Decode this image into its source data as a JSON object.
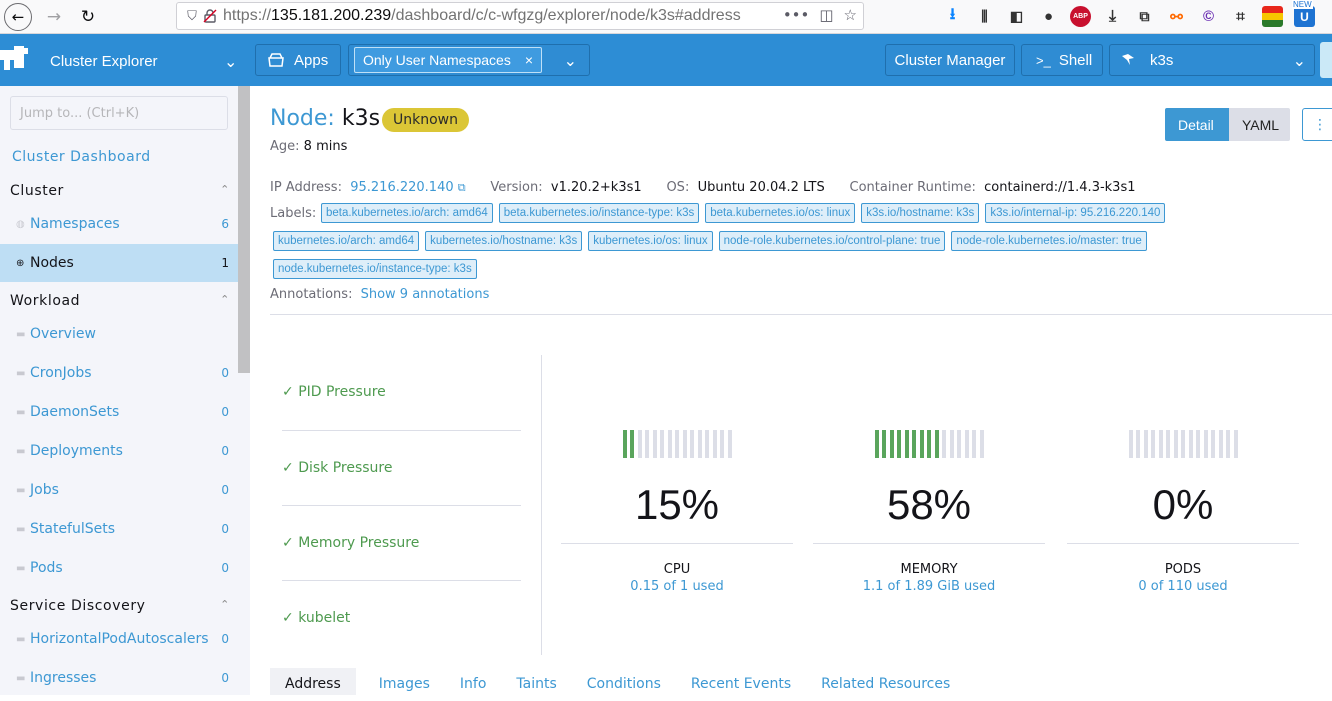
{
  "browser": {
    "url_prefix": "https://",
    "url_host": "135.181.200.239",
    "url_path": "/dashboard/c/c-wfgzg/explorer/node/k3s#address",
    "more": "•••",
    "abp_label": "ABP",
    "new_badge": "NEW"
  },
  "header": {
    "product": "Cluster Explorer",
    "apps": "Apps",
    "namespace_filter": "Only User Namespaces",
    "namespace_remove": "×",
    "cluster_manager": "Cluster Manager",
    "shell": "Shell",
    "cluster": "k3s"
  },
  "sidebar": {
    "jump_placeholder": "Jump to... (Ctrl+K)",
    "dashboard_link": "Cluster Dashboard",
    "groups": [
      {
        "title": "Cluster",
        "items": [
          {
            "label": "Namespaces",
            "count": "6"
          },
          {
            "label": "Nodes",
            "count": "1"
          }
        ]
      },
      {
        "title": "Workload",
        "items": [
          {
            "label": "Overview",
            "count": ""
          },
          {
            "label": "CronJobs",
            "count": "0"
          },
          {
            "label": "DaemonSets",
            "count": "0"
          },
          {
            "label": "Deployments",
            "count": "0"
          },
          {
            "label": "Jobs",
            "count": "0"
          },
          {
            "label": "StatefulSets",
            "count": "0"
          },
          {
            "label": "Pods",
            "count": "0"
          }
        ]
      },
      {
        "title": "Service Discovery",
        "items": [
          {
            "label": "HorizontalPodAutoscalers",
            "count": "0"
          },
          {
            "label": "Ingresses",
            "count": "0"
          }
        ]
      }
    ]
  },
  "node": {
    "kind": "Node:",
    "name": "k3s",
    "state": "Unknown",
    "age_label": "Age:",
    "age_value": "8 mins",
    "mode_detail": "Detail",
    "mode_yaml": "YAML",
    "ip_label": "IP Address:",
    "ip_value": "95.216.220.140",
    "version_label": "Version:",
    "version_value": "v1.20.2+k3s1",
    "os_label": "OS:",
    "os_value": "Ubuntu 20.04.2 LTS",
    "runtime_label": "Container Runtime:",
    "runtime_value": "containerd://1.4.3-k3s1",
    "labels_label": "Labels:",
    "labels": [
      "beta.kubernetes.io/arch: amd64",
      "beta.kubernetes.io/instance-type: k3s",
      "beta.kubernetes.io/os: linux",
      "k3s.io/hostname: k3s",
      "k3s.io/internal-ip: 95.216.220.140",
      "kubernetes.io/arch: amd64",
      "kubernetes.io/hostname: k3s",
      "kubernetes.io/os: linux",
      "node-role.kubernetes.io/control-plane: true",
      "node-role.kubernetes.io/master: true",
      "node.kubernetes.io/instance-type: k3s"
    ],
    "annotations_label": "Annotations:",
    "annotations_link": "Show 9 annotations"
  },
  "conditions": [
    "PID Pressure",
    "Disk Pressure",
    "Memory Pressure",
    "kubelet"
  ],
  "gauges": [
    {
      "name": "CPU",
      "percent": "15%",
      "fraction": 0.15,
      "used": "0.15 of 1 used"
    },
    {
      "name": "MEMORY",
      "percent": "58%",
      "fraction": 0.58,
      "used": "1.1 of 1.89 GiB used"
    },
    {
      "name": "PODS",
      "percent": "0%",
      "fraction": 0.0,
      "used": "0 of 110 used"
    }
  ],
  "tabs": [
    "Address",
    "Images",
    "Info",
    "Taints",
    "Conditions",
    "Recent Events",
    "Related Resources"
  ],
  "colors": {
    "brand": "#2d8dd5",
    "link": "#3d98d3",
    "success": "#5aa55c",
    "warning_badge": "#dbc636"
  }
}
